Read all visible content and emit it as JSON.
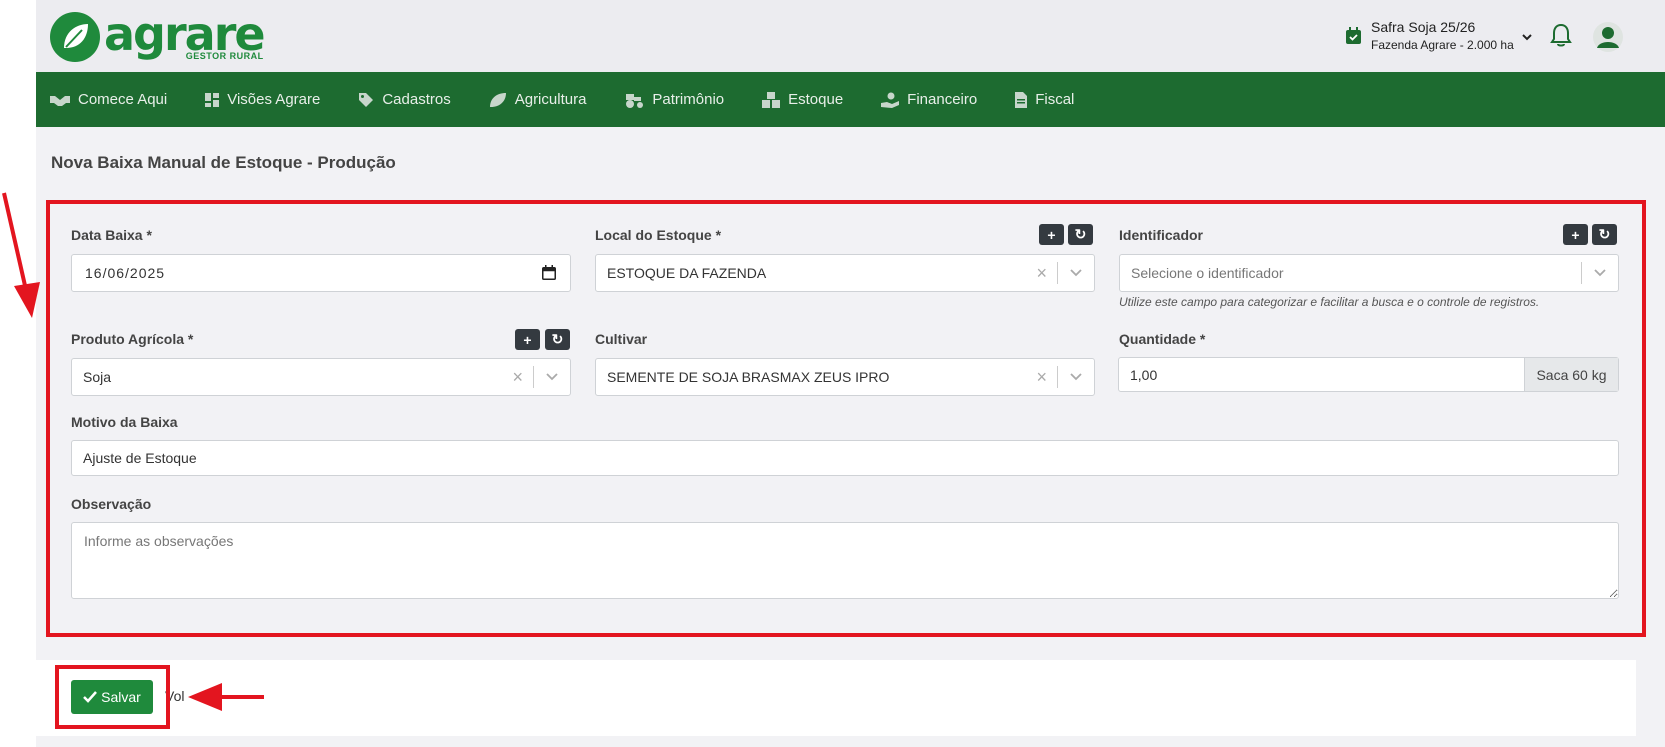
{
  "header": {
    "logo_word": "agrare",
    "logo_sub": "GESTOR RURAL",
    "safra_title": "Safra Soja 25/26",
    "safra_farm": "Fazenda Agrare - 2.000 ha"
  },
  "nav": {
    "items": [
      {
        "label": "Comece Aqui",
        "icon": "handshake-icon"
      },
      {
        "label": "Visões Agrare",
        "icon": "dashboard-icon"
      },
      {
        "label": "Cadastros",
        "icon": "tags-icon"
      },
      {
        "label": "Agricultura",
        "icon": "leaf-icon"
      },
      {
        "label": "Patrimônio",
        "icon": "tractor-icon"
      },
      {
        "label": "Estoque",
        "icon": "boxes-icon"
      },
      {
        "label": "Financeiro",
        "icon": "hand-money-icon"
      },
      {
        "label": "Fiscal",
        "icon": "document-icon"
      }
    ]
  },
  "page": {
    "title": "Nova Baixa Manual de Estoque - Produção"
  },
  "form": {
    "data_baixa": {
      "label": "Data Baixa *",
      "value": "16/06/2025"
    },
    "local_estoque": {
      "label": "Local do Estoque *",
      "value": "ESTOQUE DA FAZENDA"
    },
    "identificador": {
      "label": "Identificador",
      "placeholder": "Selecione o identificador",
      "hint": "Utilize este campo para categorizar e facilitar a busca e o controle de registros."
    },
    "produto": {
      "label": "Produto Agrícola *",
      "value": "Soja"
    },
    "cultivar": {
      "label": "Cultivar",
      "value": "SEMENTE DE SOJA BRASMAX ZEUS IPRO"
    },
    "quantidade": {
      "label": "Quantidade *",
      "value": "1,00",
      "unit": "Saca 60 kg"
    },
    "motivo": {
      "label": "Motivo da Baixa",
      "value": "Ajuste de Estoque"
    },
    "observacao": {
      "label": "Observação",
      "placeholder": "Informe as observações"
    },
    "add_symbol": "+",
    "refresh_symbol": "↻"
  },
  "footer": {
    "save_label": "Salvar",
    "after_text": "Vol"
  },
  "colors": {
    "brand_green": "#1f8a3c",
    "nav_green": "#1d6b30",
    "highlight_red": "#e3151f"
  }
}
